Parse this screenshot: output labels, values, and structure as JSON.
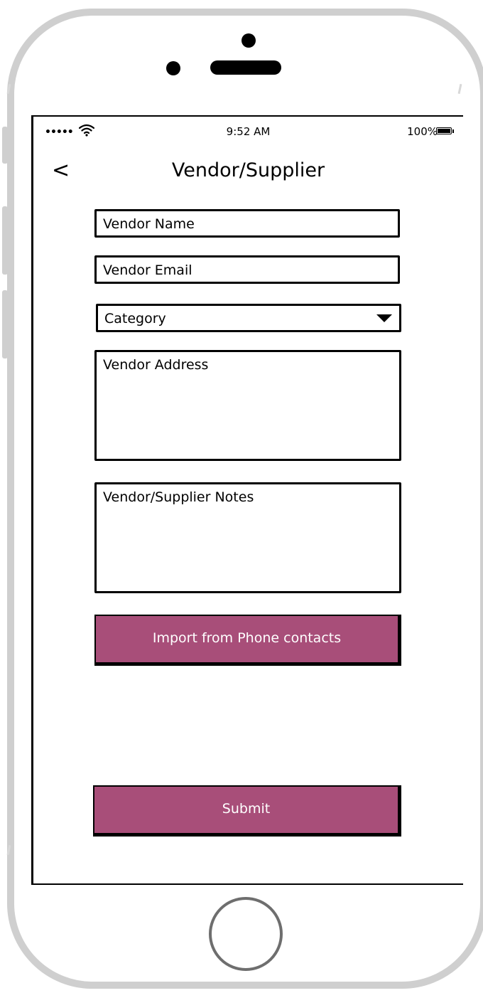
{
  "status_bar": {
    "signal": "•••••",
    "time": "9:52 AM",
    "battery": "100%"
  },
  "nav": {
    "back": "<",
    "title": "Vendor/Supplier"
  },
  "form": {
    "vendor_name": "Vendor Name",
    "vendor_email": "Vendor Email",
    "category": "Category",
    "vendor_address": "Vendor Address",
    "notes": "Vendor/Supplier Notes"
  },
  "buttons": {
    "import": "Import from Phone contacts",
    "submit": "Submit"
  },
  "colors": {
    "button_fill": "#a84e79",
    "frame": "#cfcfcf"
  },
  "icons": {
    "wifi": "wifi-icon",
    "battery": "battery-icon",
    "back": "chevron-left-icon",
    "dropdown": "caret-down-icon"
  }
}
